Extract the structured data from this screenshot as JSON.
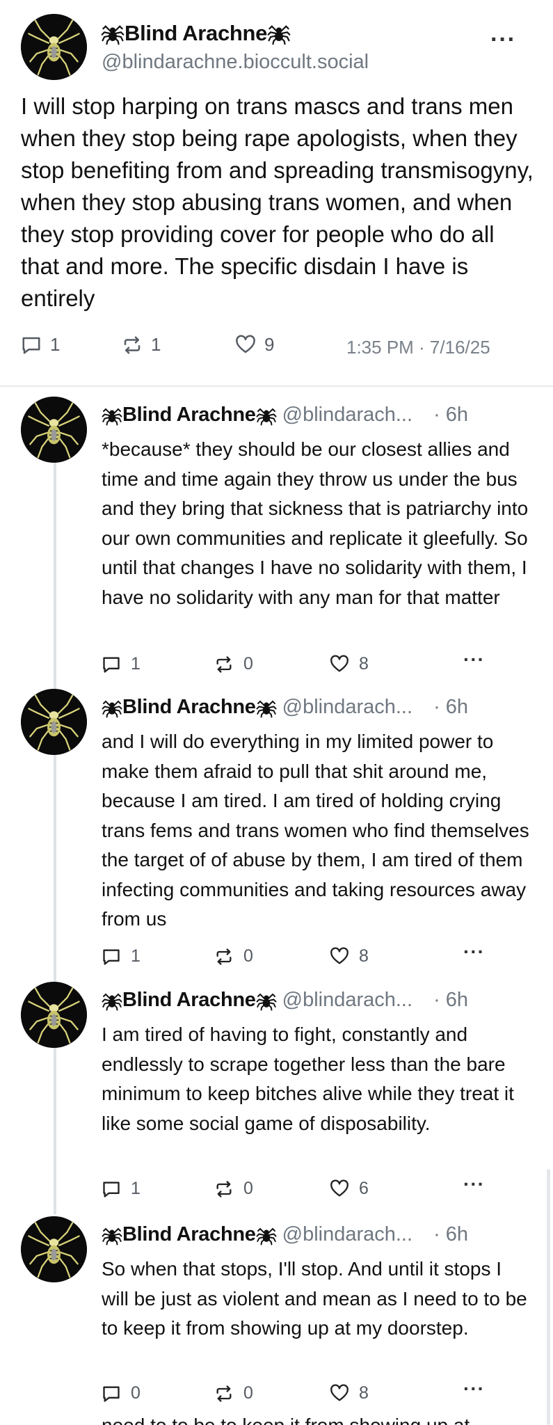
{
  "main_post": {
    "display_name": "Blind Arachne",
    "handle": "@blindarachne.bioccult.social",
    "text": "I will stop harping on trans mascs and trans men when they stop being rape apologists, when they stop benefiting from and spreading transmisogyny, when they stop abusing trans women, and when they stop providing cover for people who do all that and more. The specific disdain I have is entirely",
    "replies": "1",
    "reposts": "1",
    "likes": "9",
    "timestamp": "1:35 PM · 7/16/25",
    "more_label": "···"
  },
  "replies": [
    {
      "display_name": "Blind Arachne",
      "handle": "@blindarach...",
      "time": "· 6h",
      "text": "*because* they should be our closest allies and time and time again they throw us under the bus and they bring that sickness that is patriarchy into our own communities and replicate it gleefully. So until that changes I have no solidarity with them, I have no solidarity with any man for that matter",
      "replies": "1",
      "reposts": "0",
      "likes": "8",
      "more_label": "···"
    },
    {
      "display_name": "Blind Arachne",
      "handle": "@blindarach...",
      "time": "· 6h",
      "text": "and I will do everything in my limited power to make them afraid to pull that shit around me, because I am tired. I am tired of holding crying trans fems and trans women who find themselves the target of of abuse by them, I am tired of them infecting communities and taking resources away from us",
      "replies": "1",
      "reposts": "0",
      "likes": "8",
      "more_label": "···"
    },
    {
      "display_name": "Blind Arachne",
      "handle": "@blindarach...",
      "time": "· 6h",
      "text": "I am tired of having to fight, constantly and endlessly to scrape together less than the bare minimum to keep bitches alive while they treat it like some social game of disposability.",
      "replies": "1",
      "reposts": "0",
      "likes": "6",
      "more_label": "···"
    },
    {
      "display_name": "Blind Arachne",
      "handle": "@blindarach...",
      "time": "· 6h",
      "text": "So when that stops, I'll stop. And until it stops I will be just as violent and mean as I need to to be to keep it from showing up at my doorstep.",
      "replies": "0",
      "reposts": "0",
      "likes": "8",
      "more_label": "···"
    }
  ],
  "clipped_text": "need to to be to keep it from showing up at",
  "icons": {
    "name_emoji": "spider-icon",
    "reply": "reply-icon",
    "repost": "repost-icon",
    "like": "heart-icon",
    "more": "more-icon"
  }
}
